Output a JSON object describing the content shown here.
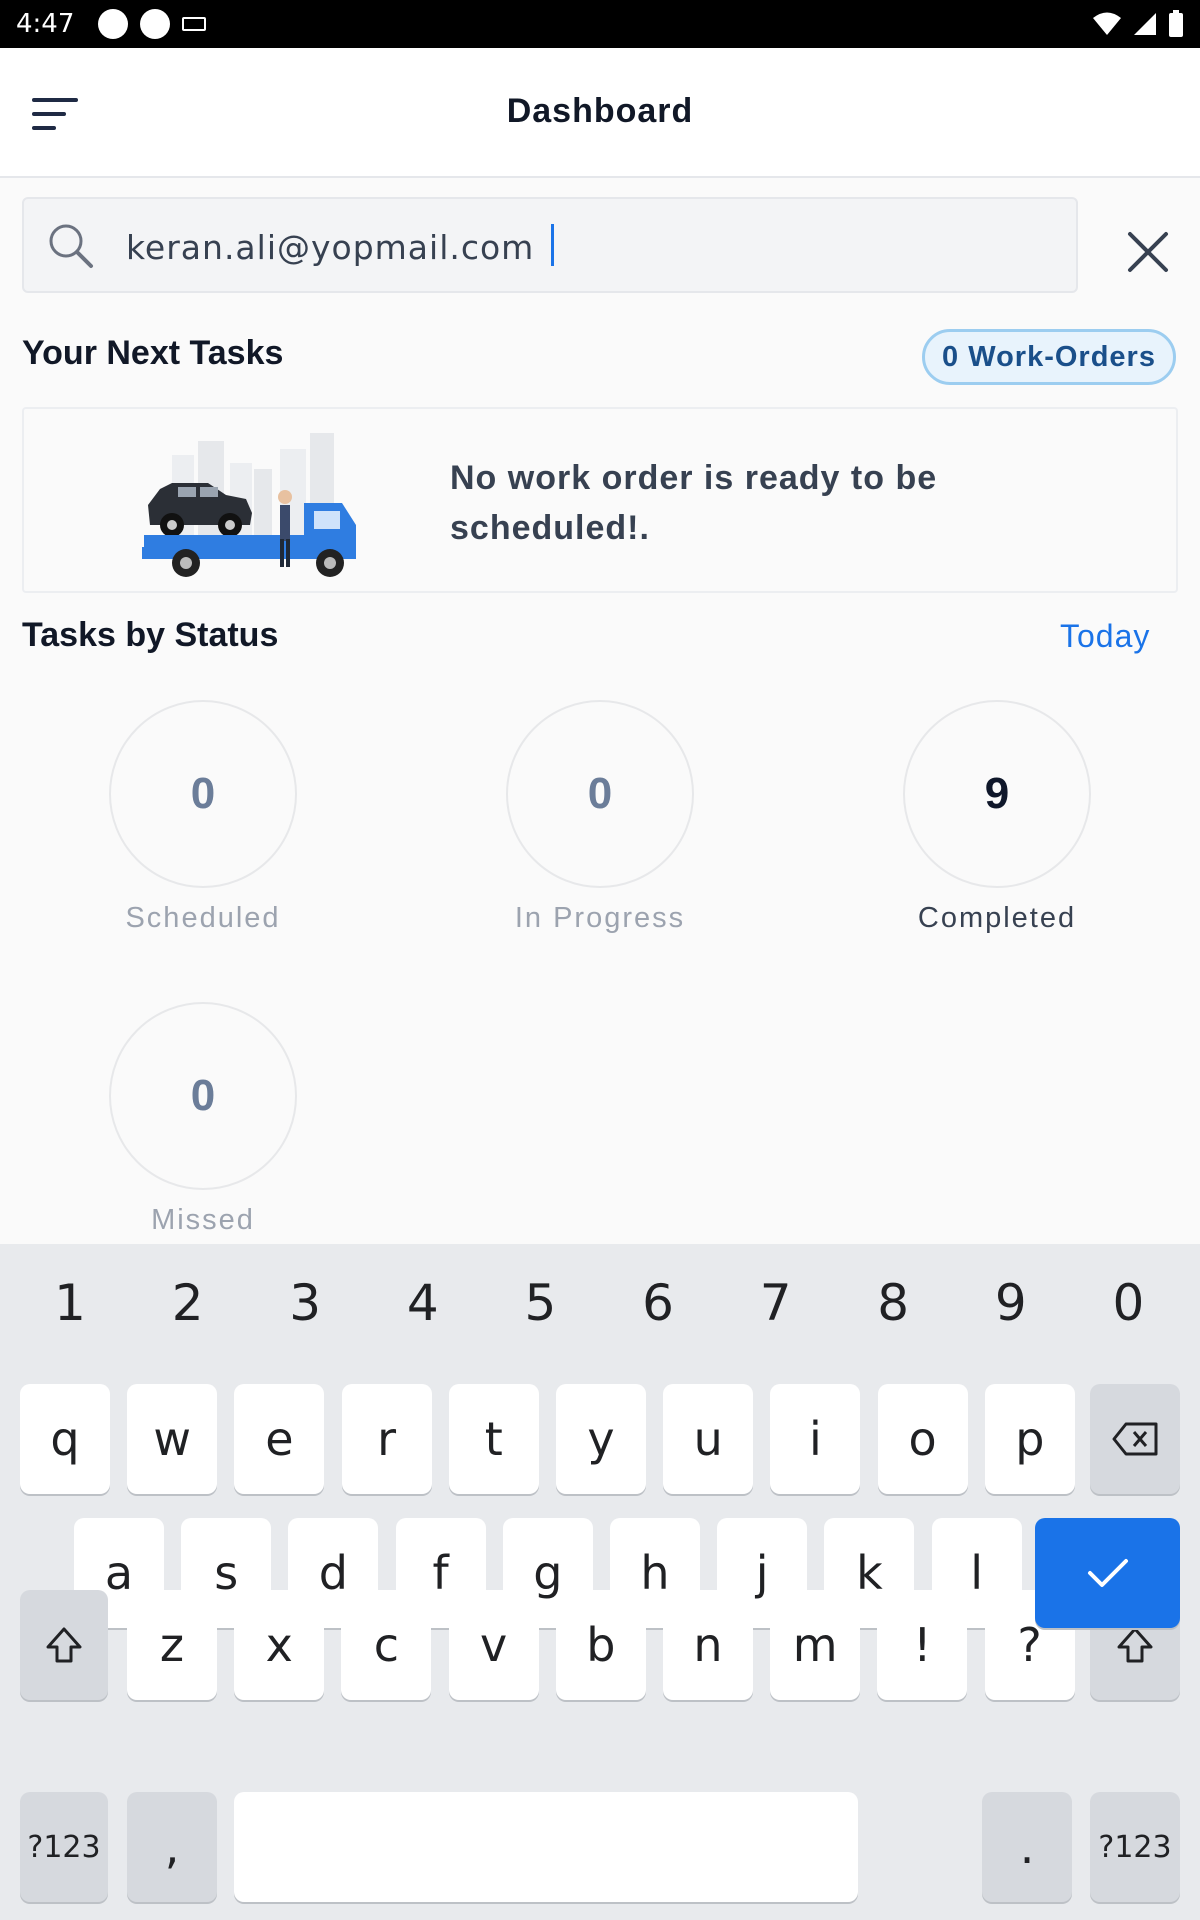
{
  "status_bar": {
    "time": "4:47"
  },
  "header": {
    "title": "Dashboard"
  },
  "search": {
    "value": "keran.ali@yopmail.com"
  },
  "next_tasks": {
    "title": "Your Next Tasks",
    "badge": "0 Work-Orders",
    "empty_message": "No work order is ready to be scheduled!."
  },
  "tasks_by_status": {
    "title": "Tasks by Status",
    "filter": "Today",
    "items": [
      {
        "count": "0",
        "label": "Scheduled"
      },
      {
        "count": "0",
        "label": "In Progress"
      },
      {
        "count": "9",
        "label": "Completed"
      },
      {
        "count": "0",
        "label": "Missed"
      }
    ]
  },
  "keyboard": {
    "numbers": [
      "1",
      "2",
      "3",
      "4",
      "5",
      "6",
      "7",
      "8",
      "9",
      "0"
    ],
    "row1": [
      "q",
      "w",
      "e",
      "r",
      "t",
      "y",
      "u",
      "i",
      "o",
      "p"
    ],
    "row2": [
      "a",
      "s",
      "d",
      "f",
      "g",
      "h",
      "j",
      "k",
      "l"
    ],
    "row3": [
      "z",
      "x",
      "c",
      "v",
      "b",
      "n",
      "m",
      "!",
      "?"
    ],
    "symbols_label": "?123",
    "comma": ",",
    "period": "."
  },
  "colors": {
    "accent": "#1a73e8",
    "badge_border": "#9ccdf0",
    "badge_text": "#1a4f8a"
  }
}
